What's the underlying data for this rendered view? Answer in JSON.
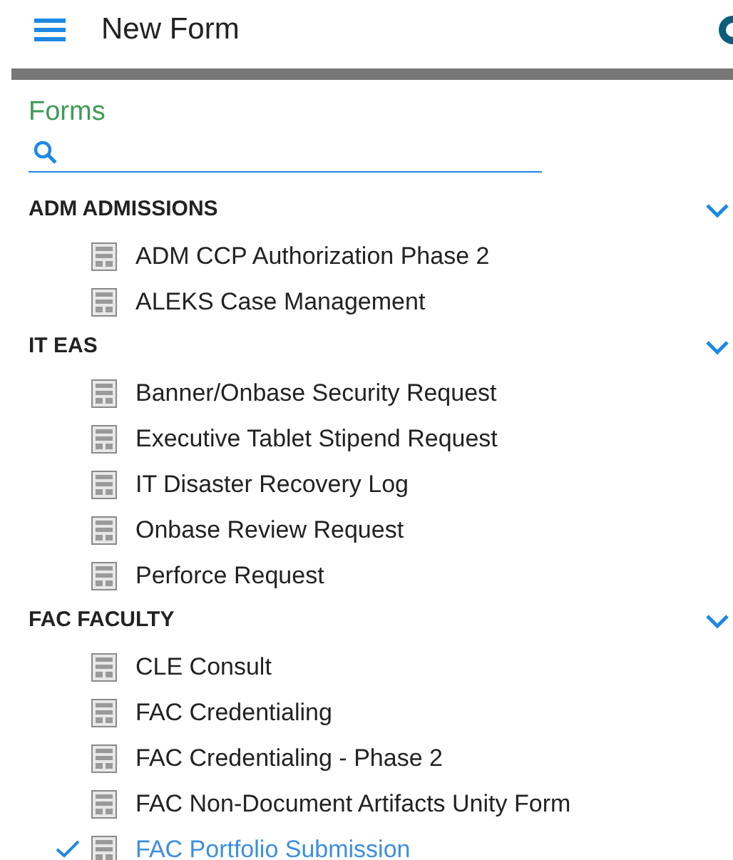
{
  "header": {
    "title": "New Form"
  },
  "panel": {
    "title": "Forms"
  },
  "groups": [
    {
      "name": "ADM ADMISSIONS",
      "expanded": true,
      "items": [
        {
          "label": "ADM CCP Authorization Phase 2",
          "selected": false
        },
        {
          "label": "ALEKS Case Management",
          "selected": false
        }
      ]
    },
    {
      "name": "IT EAS",
      "expanded": true,
      "items": [
        {
          "label": "Banner/Onbase Security Request",
          "selected": false
        },
        {
          "label": "Executive Tablet Stipend Request",
          "selected": false
        },
        {
          "label": "IT Disaster Recovery Log",
          "selected": false
        },
        {
          "label": "Onbase Review Request",
          "selected": false
        },
        {
          "label": "Perforce Request",
          "selected": false
        }
      ]
    },
    {
      "name": "FAC FACULTY",
      "expanded": true,
      "items": [
        {
          "label": "CLE Consult",
          "selected": false
        },
        {
          "label": "FAC Credentialing",
          "selected": false
        },
        {
          "label": "FAC Credentialing - Phase 2",
          "selected": false
        },
        {
          "label": "FAC Non-Document Artifacts Unity Form",
          "selected": false
        },
        {
          "label": "FAC Portfolio Submission",
          "selected": true
        }
      ]
    }
  ]
}
